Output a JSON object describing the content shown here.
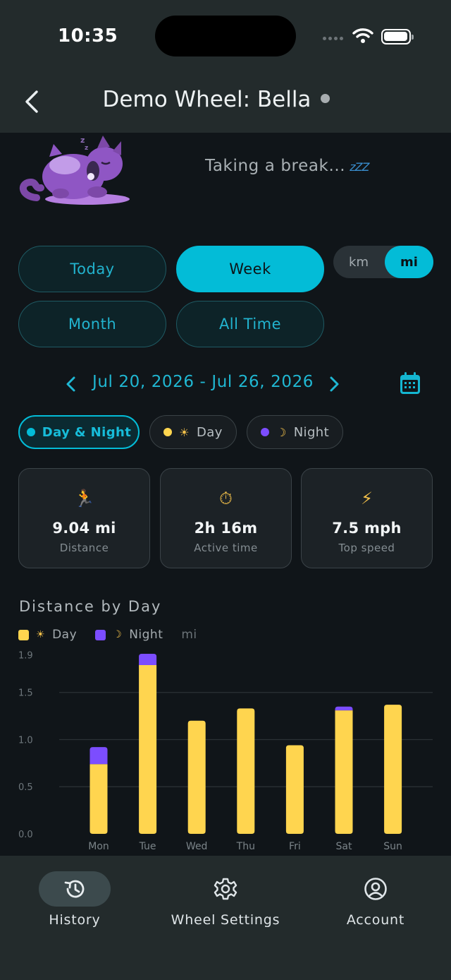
{
  "status_bar": {
    "time": "10:35"
  },
  "nav": {
    "title": "Demo Wheel: Bella",
    "back_icon": "chevron-left-icon"
  },
  "mascot": {
    "message": "Taking a break...",
    "zzz": "zZZ"
  },
  "range_tabs": [
    {
      "label": "Today",
      "active": false
    },
    {
      "label": "Week",
      "active": true
    },
    {
      "label": "Month",
      "active": false
    },
    {
      "label": "All Time",
      "active": false
    }
  ],
  "units": {
    "km": "km",
    "mi": "mi",
    "selected": "mi"
  },
  "date_nav": {
    "range": "Jul 20, 2026 - Jul 26, 2026"
  },
  "filters": [
    {
      "label": "Day & Night",
      "dot_color": "#03bcd7",
      "active": true,
      "symbol": ""
    },
    {
      "label": "Day",
      "dot_color": "#ffd54f",
      "active": false,
      "symbol": "☀"
    },
    {
      "label": "Night",
      "dot_color": "#7c4dff",
      "active": false,
      "symbol": "☽"
    }
  ],
  "stats": [
    {
      "icon": "runner-icon",
      "value": "9.04 mi",
      "label": "Distance"
    },
    {
      "icon": "stopwatch-icon",
      "value": "2h 16m",
      "label": "Active time"
    },
    {
      "icon": "lightning-icon",
      "value": "7.5 mph",
      "label": "Top speed"
    }
  ],
  "chart": {
    "title": "Distance by Day",
    "legend": {
      "day": "Day",
      "night": "Night",
      "unit": "mi"
    }
  },
  "chart_data": {
    "type": "bar",
    "stacked": true,
    "title": "Distance by Day",
    "categories": [
      "Mon",
      "Tue",
      "Wed",
      "Thu",
      "Fri",
      "Sat",
      "Sun"
    ],
    "series": [
      {
        "name": "Day",
        "color": "#ffd54f",
        "values": [
          0.74,
          1.79,
          1.2,
          1.33,
          0.94,
          1.31,
          1.37
        ]
      },
      {
        "name": "Night",
        "color": "#7c4dff",
        "values": [
          0.18,
          0.12,
          0,
          0,
          0,
          0.04,
          0
        ]
      }
    ],
    "y_ticks": [
      "0.0",
      "0.5",
      "1.0",
      "1.5",
      "1.9"
    ],
    "ylim": [
      0,
      1.91
    ],
    "ylabel": "mi",
    "grid": true
  },
  "tabbar": [
    {
      "label": "History",
      "icon": "history-icon",
      "active": true
    },
    {
      "label": "Wheel Settings",
      "icon": "gear-icon",
      "active": false
    },
    {
      "label": "Account",
      "icon": "account-icon",
      "active": false
    }
  ]
}
